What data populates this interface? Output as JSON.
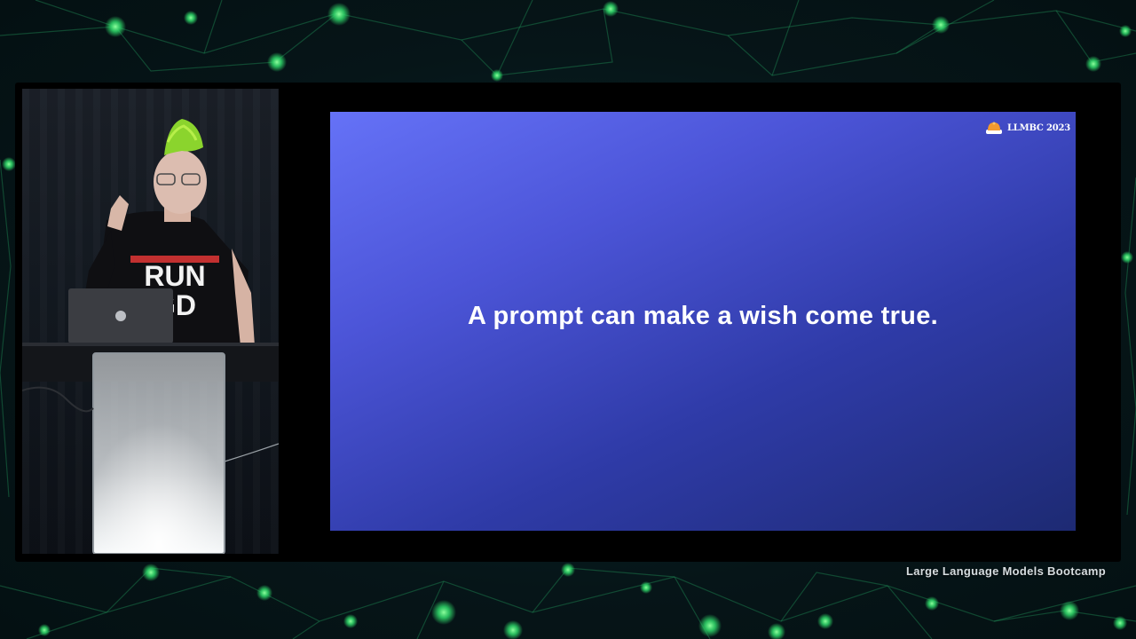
{
  "slide": {
    "statement": "A prompt can make a wish come true.",
    "badge_text": "LLMBC 2023",
    "badge_icon": "orange-dome-logo-icon"
  },
  "caption": {
    "event": "Large Language Models Bootcamp"
  },
  "speaker": {
    "shirt_text_line1": "RUN",
    "shirt_text_line2": "GD"
  },
  "colors": {
    "slide_gradient_start": "#6572f7",
    "slide_gradient_end": "#1d2a73",
    "network_glow": "#2fd96a",
    "frame": "#000000"
  }
}
